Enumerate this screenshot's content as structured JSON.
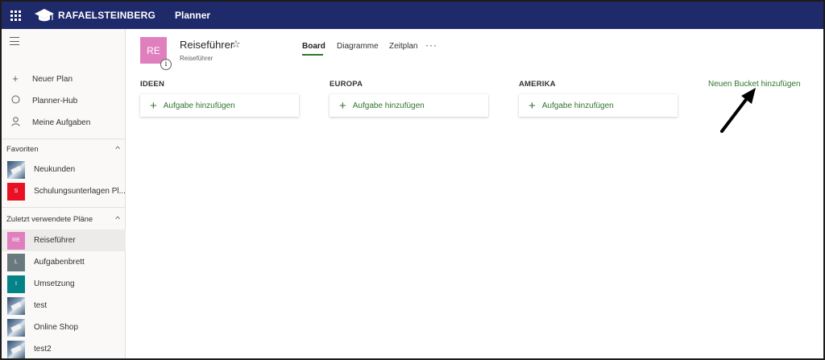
{
  "topbar": {
    "brand": "RAFAELSTEINBERG",
    "app_name": "Planner",
    "color": "#1f2a6b"
  },
  "sidebar": {
    "nav": [
      {
        "label": "Neuer Plan",
        "icon": "plus-icon"
      },
      {
        "label": "Planner-Hub",
        "icon": "circle-icon"
      },
      {
        "label": "Meine Aufgaben",
        "icon": "person-icon"
      }
    ],
    "favorites": {
      "title": "Favoriten",
      "items": [
        {
          "label": "Neukunden",
          "tile": "photo"
        },
        {
          "label": "Schulungsunterlagen Pl...",
          "tile": "S",
          "color": "#e81123"
        }
      ]
    },
    "recent": {
      "title": "Zuletzt verwendete Pläne",
      "items": [
        {
          "label": "Reiseführer",
          "tile": "RE",
          "color": "#e07fbe",
          "selected": true
        },
        {
          "label": "Aufgabenbrett",
          "tile": "L",
          "color": "#69797e"
        },
        {
          "label": "Umsetzung",
          "tile": "I",
          "color": "#038387"
        },
        {
          "label": "test",
          "tile": "photo"
        },
        {
          "label": "Online Shop",
          "tile": "photo"
        },
        {
          "label": "test2",
          "tile": "photo"
        }
      ]
    }
  },
  "plan": {
    "initials": "RE",
    "title": "Reiseführer",
    "subtitle": "Reiseführer",
    "info_glyph": "i",
    "star": "☆",
    "tile_color": "#e07fbe"
  },
  "tabs": [
    {
      "label": "Board",
      "active": true
    },
    {
      "label": "Diagramme",
      "active": false
    },
    {
      "label": "Zeitplan",
      "active": false
    }
  ],
  "more_glyph": "···",
  "buckets": [
    {
      "title": "IDEEN",
      "add_label": "Aufgabe hinzufügen"
    },
    {
      "title": "EUROPA",
      "add_label": "Aufgabe hinzufügen"
    },
    {
      "title": "AMERIKA",
      "add_label": "Aufgabe hinzufügen"
    }
  ],
  "add_glyph": "+",
  "new_bucket_label": "Neuen Bucket hinzufügen",
  "accent": "#31752f"
}
